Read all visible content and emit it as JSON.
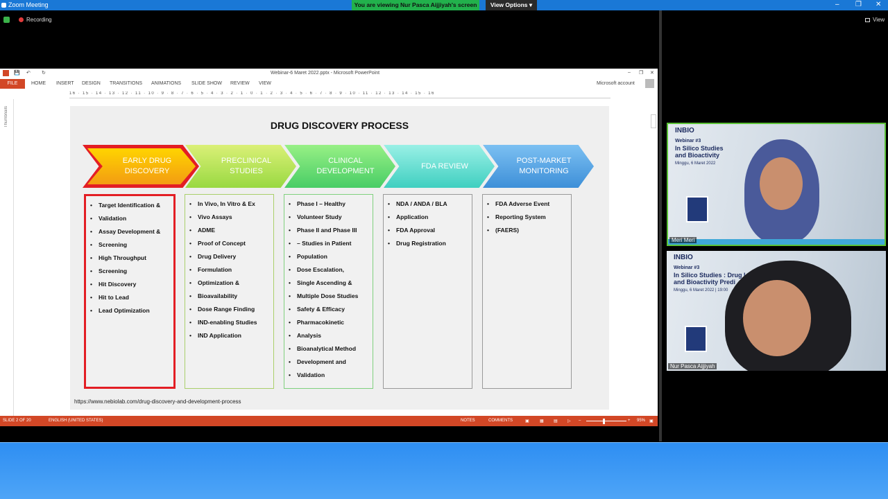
{
  "zoom": {
    "window_title": "Zoom Meeting",
    "viewing_banner": "You are viewing Nur Pasca Aijjiyah's screen",
    "view_options": "View Options ▾",
    "recording": "Recording",
    "view_button": "View",
    "colors": {
      "title_bar": "#1a78d6",
      "viewing_banner": "#22b14c",
      "bottom_bar": "#2e8ef2"
    }
  },
  "powerpoint": {
    "title": "Webinar-6 Maret 2022.pptx - Microsoft PowerPoint",
    "file_tab": "FILE",
    "tabs": [
      "HOME",
      "INSERT",
      "DESIGN",
      "TRANSITIONS",
      "ANIMATIONS",
      "SLIDE SHOW",
      "REVIEW",
      "VIEW"
    ],
    "account": "Microsoft account",
    "thumbnails_label": "Thumbnails",
    "ruler": "16 · 15 · 14 · 13 · 12 · 11 · 10 · 9 · 8 · 7 · 6 · 5 · 4 · 3 · 2 · 1 · 0 · 1 · 2 · 3 · 4 · 5 · 6 · 7 · 8 · 9 · 10 · 11 · 12 · 13 · 14 · 15 · 16",
    "status": {
      "slide": "SLIDE 2 OF 20",
      "language": "ENGLISH (UNITED STATES)",
      "notes": "NOTES",
      "comments": "COMMENTS",
      "zoom": "95%"
    }
  },
  "slide": {
    "title": "DRUG DISCOVERY PROCESS",
    "url": "https://www.nebiolab.com/drug-discovery-and-development-process",
    "stages": [
      {
        "label_1": "EARLY DRUG",
        "label_2": "DISCOVERY",
        "color": "#f3b21a",
        "items": [
          "Target Identification &",
          "Validation",
          "Assay Development &",
          "Screening",
          "High Throughput",
          "Screening",
          "Hit Discovery",
          "Hit to Lead",
          "Lead Optimization"
        ]
      },
      {
        "label_1": "PRECLINICAL",
        "label_2": "STUDIES",
        "color": "#a8e03a",
        "items": [
          "In Vivo, In Vitro & Ex",
          "Vivo Assays",
          "ADME",
          "Proof of Concept",
          "Drug Delivery",
          "Formulation",
          "Optimization &",
          "Bioavailability",
          "Dose Range Finding",
          "IND-enabling Studies",
          "IND Application"
        ]
      },
      {
        "label_1": "CLINICAL",
        "label_2": "DEVELOPMENT",
        "color": "#54d86a",
        "items": [
          "Phase I – Healthy",
          "Volunteer Study",
          "Phase II and Phase III",
          "– Studies in Patient",
          "Population",
          "Dose Escalation,",
          "Single Ascending &",
          "Multiple Dose Studies",
          "Safety & Efficacy",
          "Pharmacokinetic",
          "Analysis",
          "Bioanalytical Method",
          "Development and",
          "Validation"
        ]
      },
      {
        "label_1": "FDA REVIEW",
        "label_2": "",
        "color": "#57d4c8",
        "items": [
          "NDA / ANDA / BLA",
          "Application",
          "FDA Approval",
          "Drug Registration"
        ]
      },
      {
        "label_1": "POST-MARKET",
        "label_2": "MONITORING",
        "color": "#4a9ee0",
        "items": [
          "FDA Adverse Event",
          "Reporting System",
          "(FAERS)"
        ]
      }
    ]
  },
  "videos": [
    {
      "name": "Meri Meri",
      "brand": "INBIO",
      "webinar": "Webinar #3",
      "topic": "In Silico Studies",
      "topic2": "and Bioactivity",
      "date": "Minggu, 6 Maret 2022"
    },
    {
      "name": "Nur Pasca Aijjiyah",
      "brand": "INBIO",
      "webinar": "Webinar #3",
      "topic": "In Silico Studies : Drug L",
      "topic2": "and Bioactivity Predi",
      "date": "Minggu, 6 Maret 2022 | 19:00"
    }
  ]
}
